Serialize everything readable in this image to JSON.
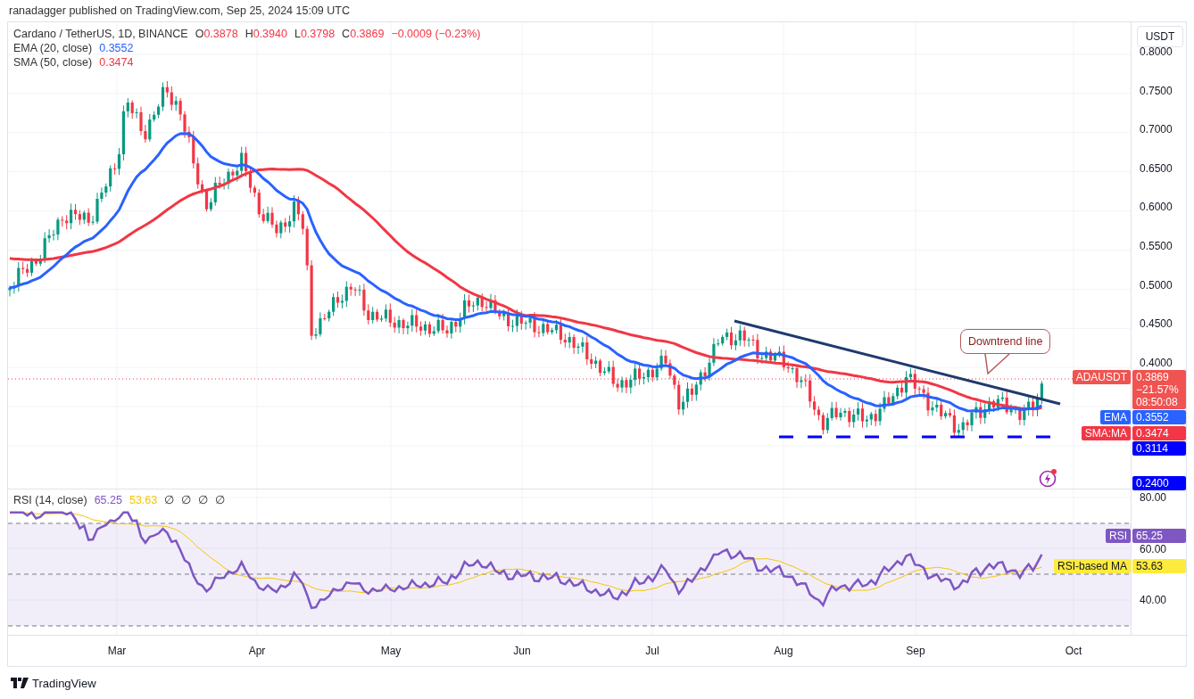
{
  "header": {
    "text": "ranadagger published on TradingView.com, Sep 25, 2024 15:09 UTC"
  },
  "legend": {
    "symbol": "Cardano / TetherUS, 1D, BINANCE",
    "ohlc": [
      {
        "label": "O",
        "value": "0.3878"
      },
      {
        "label": "H",
        "value": "0.3940"
      },
      {
        "label": "L",
        "value": "0.3798"
      },
      {
        "label": "C",
        "value": "0.3869"
      }
    ],
    "change": "−0.0009 (−0.23%)"
  },
  "indicators": [
    {
      "name": "EMA (20, close)",
      "value": "0.3552",
      "color": "#2962ff"
    },
    {
      "name": "SMA (50, close)",
      "value": "0.3474",
      "color": "#f23645"
    }
  ],
  "annotation": {
    "text": "Downtrend line"
  },
  "price_axis": {
    "currency": "USDT",
    "ticks": [
      "0.8000",
      "0.7500",
      "0.7000",
      "0.6500",
      "0.6000",
      "0.5500",
      "0.5000",
      "0.4500",
      "0.4000"
    ],
    "badges": [
      {
        "label": "ADAUSDT",
        "lines": [
          "0.3869",
          "−21.57%",
          "08:50:08"
        ],
        "color": "#f05350"
      },
      {
        "label": "EMA",
        "lines": [
          "0.3552"
        ],
        "color": "#2962ff"
      },
      {
        "label": "SMA:MA",
        "lines": [
          "0.3474"
        ],
        "color": "#f23645"
      },
      {
        "lines": [
          "0.3114"
        ],
        "color": "#0000ff"
      },
      {
        "lines": [
          "0.2400"
        ],
        "color": "#0000ff"
      }
    ]
  },
  "rsi": {
    "legend": "RSI (14, close)",
    "values": [
      {
        "text": "65.25",
        "color": "#7e57c2"
      },
      {
        "text": "53.63",
        "color": "#f7c500"
      }
    ],
    "extras": [
      "∅",
      "∅",
      "∅",
      "∅"
    ],
    "ticks": [
      "80.00",
      "60.00",
      "40.00"
    ],
    "badges": [
      {
        "label": "RSI",
        "value": "65.25",
        "color": "#7e57c2",
        "dark": false
      },
      {
        "label": "RSI-based MA",
        "value": "53.63",
        "color": "#ffeb3b",
        "dark": true
      }
    ]
  },
  "time_axis": [
    "Mar",
    "Apr",
    "May",
    "Jun",
    "Jul",
    "Aug",
    "Sep",
    "Oct"
  ],
  "footer": {
    "brand": "TradingView"
  }
}
